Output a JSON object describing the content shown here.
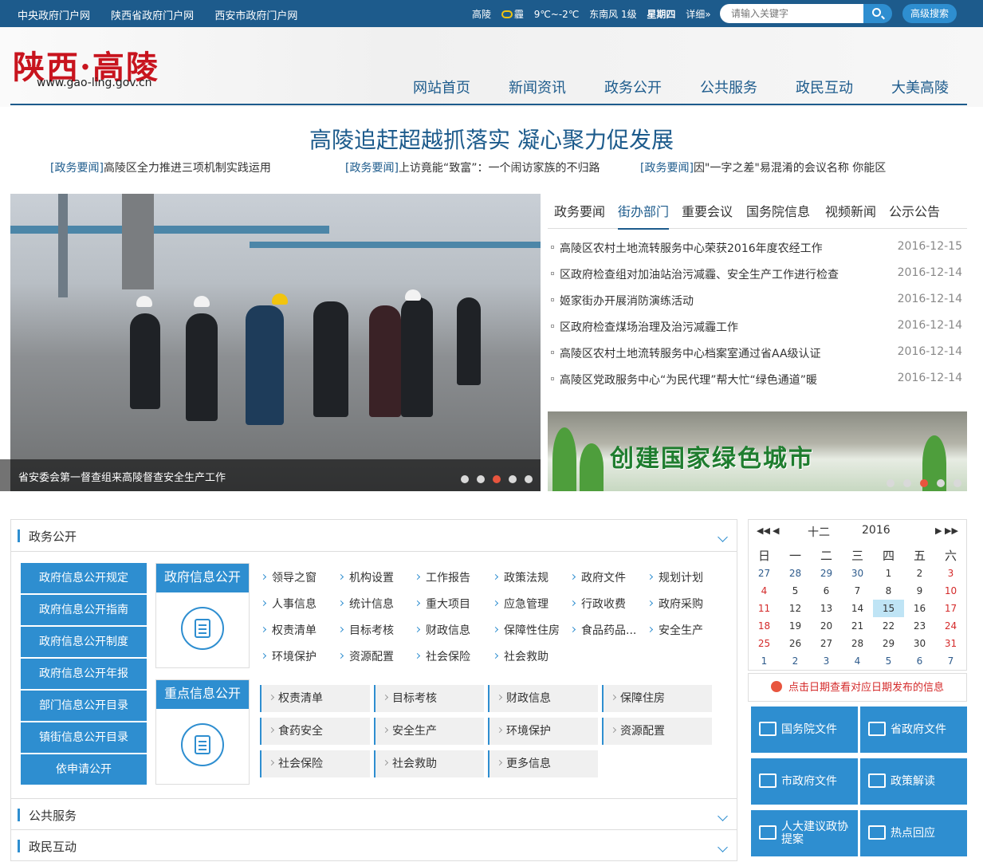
{
  "topbar": {
    "links": [
      "中央政府门户网",
      "陕西省政府门户网",
      "西安市政府门户网"
    ],
    "weather": {
      "city": "高陵",
      "condition": "霾",
      "temp": "9℃~-2℃",
      "wind": "东南风 1级",
      "day": "星期四",
      "detail": "详细»"
    },
    "search_placeholder": "请输入关键字",
    "advanced_search": "高级搜索"
  },
  "header": {
    "logo_text": "陕西·高陵",
    "logo_url": "www.gao-ling.gov.cn",
    "nav": [
      "网站首页",
      "新闻资讯",
      "政务公开",
      "公共服务",
      "政民互动",
      "大美高陵"
    ]
  },
  "headline": {
    "title": "高陵追赶超越抓落实 凝心聚力促发展",
    "subs": [
      {
        "tag": "[政务要闻]",
        "text": "高陵区全力推进三项机制实践运用"
      },
      {
        "tag": "[政务要闻]",
        "text": "上访竟能“致富”：一个闹访家族的不归路"
      },
      {
        "tag": "[政务要闻]",
        "text": "因\"一字之差\"易混淆的会议名称 你能区"
      }
    ]
  },
  "slider": {
    "caption": "省安委会第一督查组来高陵督查安全生产工作",
    "dot_count": 5,
    "active_dot": 3
  },
  "news_tabs": {
    "tabs": [
      "政务要闻",
      "街办部门",
      "重要会议",
      "国务院信息",
      "视频新闻",
      "公示公告"
    ],
    "active": 1,
    "items": [
      {
        "title": "高陵区农村土地流转服务中心荣获2016年度农经工作",
        "date": "2016-12-15"
      },
      {
        "title": "区政府检查组对加油站治污减霾、安全生产工作进行检查",
        "date": "2016-12-14"
      },
      {
        "title": "姬家街办开展消防演练活动",
        "date": "2016-12-14"
      },
      {
        "title": "区政府检查煤场治理及治污减霾工作",
        "date": "2016-12-14"
      },
      {
        "title": "高陵区农村土地流转服务中心档案室通过省AA级认证",
        "date": "2016-12-14"
      },
      {
        "title": "高陵区党政服务中心“为民代理”帮大忙“绿色通道”暖",
        "date": "2016-12-14"
      }
    ]
  },
  "banner": {
    "text": "创建国家绿色城市",
    "dot_count": 5,
    "active_dot": 3
  },
  "gov_open": {
    "section_title": "政务公开",
    "menu": [
      "政府信息公开规定",
      "政府信息公开指南",
      "政府信息公开制度",
      "政府信息公开年报",
      "部门信息公开目录",
      "镇街信息公开目录",
      "依申请公开"
    ],
    "card1_title": "政府信息公开",
    "card1_links": [
      "领导之窗",
      "机构设置",
      "工作报告",
      "政策法规",
      "政府文件",
      "规划计划",
      "人事信息",
      "统计信息",
      "重大项目",
      "应急管理",
      "行政收费",
      "政府采购",
      "权责清单",
      "目标考核",
      "财政信息",
      "保障性住房",
      "食品药品...",
      "安全生产",
      "环境保护",
      "资源配置",
      "社会保险",
      "社会救助"
    ],
    "card2_title": "重点信息公开",
    "card2_links": [
      "权责清单",
      "目标考核",
      "财政信息",
      "保障住房",
      "食药安全",
      "安全生产",
      "环境保护",
      "资源配置",
      "社会保险",
      "社会救助",
      "更多信息"
    ]
  },
  "sections": [
    "公共服务",
    "政民互动"
  ],
  "calendar": {
    "month": "十二",
    "year": "2016",
    "weekdays": [
      "日",
      "一",
      "二",
      "三",
      "四",
      "五",
      "六"
    ],
    "weeks": [
      [
        "27",
        "28",
        "29",
        "30",
        "1",
        "2",
        "3"
      ],
      [
        "4",
        "5",
        "6",
        "7",
        "8",
        "9",
        "10"
      ],
      [
        "11",
        "12",
        "13",
        "14",
        "15",
        "16",
        "17"
      ],
      [
        "18",
        "19",
        "20",
        "21",
        "22",
        "23",
        "24"
      ],
      [
        "25",
        "26",
        "27",
        "28",
        "29",
        "30",
        "31"
      ],
      [
        "1",
        "2",
        "3",
        "4",
        "5",
        "6",
        "7"
      ]
    ],
    "today": "15",
    "note": "点击日期查看对应日期发布的信息"
  },
  "quick_links": [
    "国务院文件",
    "省政府文件",
    "市政府文件",
    "政策解读",
    "人大建议政协提案",
    "热点回应"
  ]
}
